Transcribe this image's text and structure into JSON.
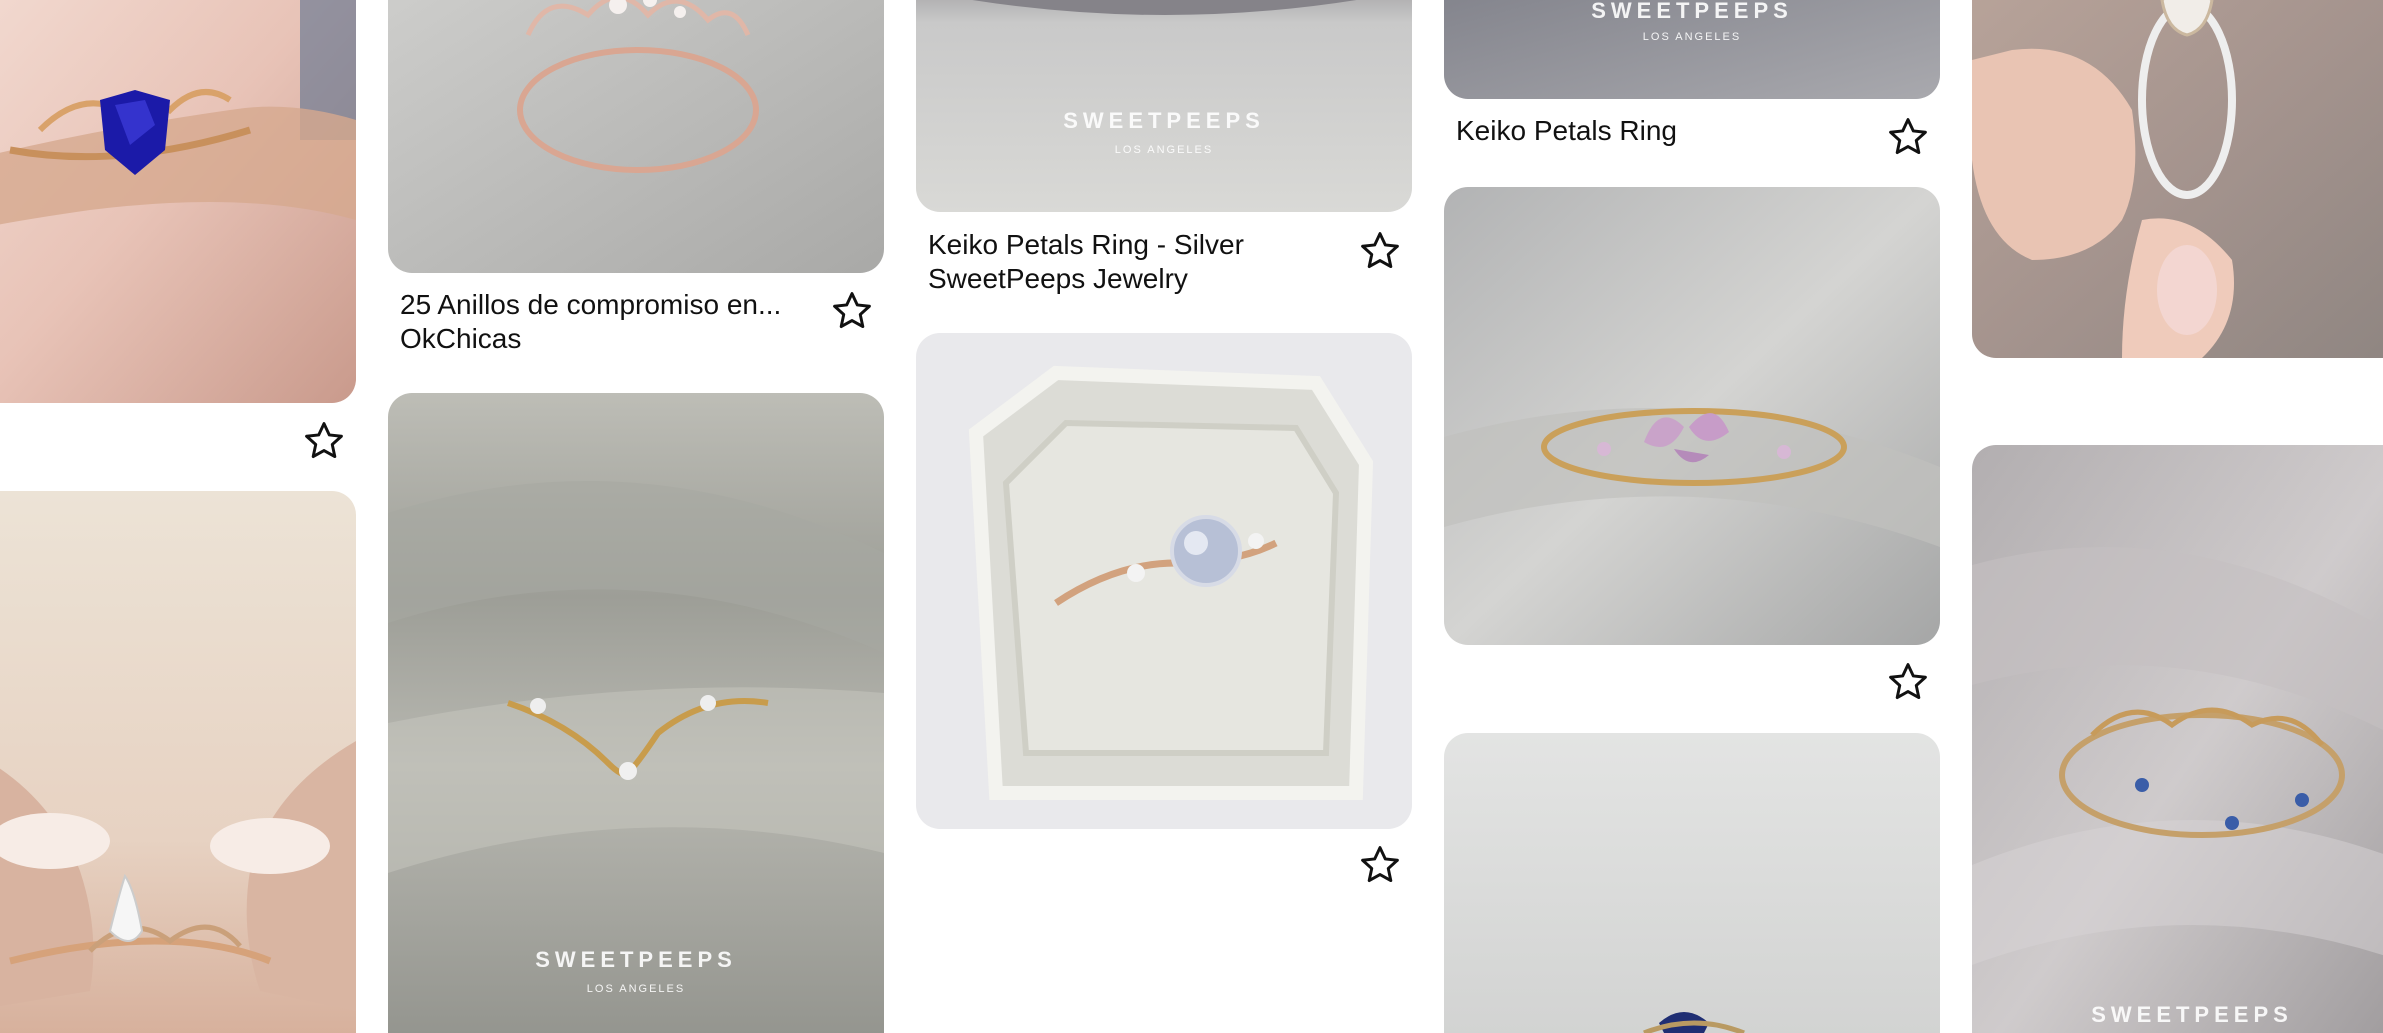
{
  "pins": [
    {
      "id": "col1-top",
      "title": "",
      "source": "",
      "watermark": ""
    },
    {
      "id": "col1-bottom",
      "title": "",
      "source": "",
      "watermark": ""
    },
    {
      "id": "col2-top",
      "title": "25 Anillos de compromiso en...",
      "source": "OkChicas",
      "watermark": ""
    },
    {
      "id": "col2-bottom",
      "title": "",
      "source": "",
      "watermark": "SWEETPEEPS",
      "watermark_sub": "LOS ANGELES"
    },
    {
      "id": "col3-top",
      "title": "Keiko Petals Ring - Silver",
      "source": "SweetPeeps Jewelry",
      "watermark": "SWEETPEEPS",
      "watermark_sub": "LOS ANGELES"
    },
    {
      "id": "col3-bottom",
      "title": "",
      "source": "",
      "watermark": ""
    },
    {
      "id": "col4-top",
      "title": "Keiko Petals Ring",
      "source": "",
      "watermark": "SWEETPEEPS",
      "watermark_sub": "LOS ANGELES"
    },
    {
      "id": "col4-middle",
      "title": "",
      "source": "",
      "watermark": ""
    },
    {
      "id": "col4-bottom",
      "title": "",
      "source": "",
      "watermark": ""
    },
    {
      "id": "col5-top",
      "title": "",
      "source": "",
      "watermark": ""
    },
    {
      "id": "col5-bottom",
      "title": "",
      "source": "",
      "watermark": "SWEETPEEPS"
    }
  ],
  "icons": {
    "save": "star-outline-icon"
  },
  "colors": {
    "background": "#ffffff",
    "text": "#111111",
    "icon_stroke": "#111111"
  }
}
